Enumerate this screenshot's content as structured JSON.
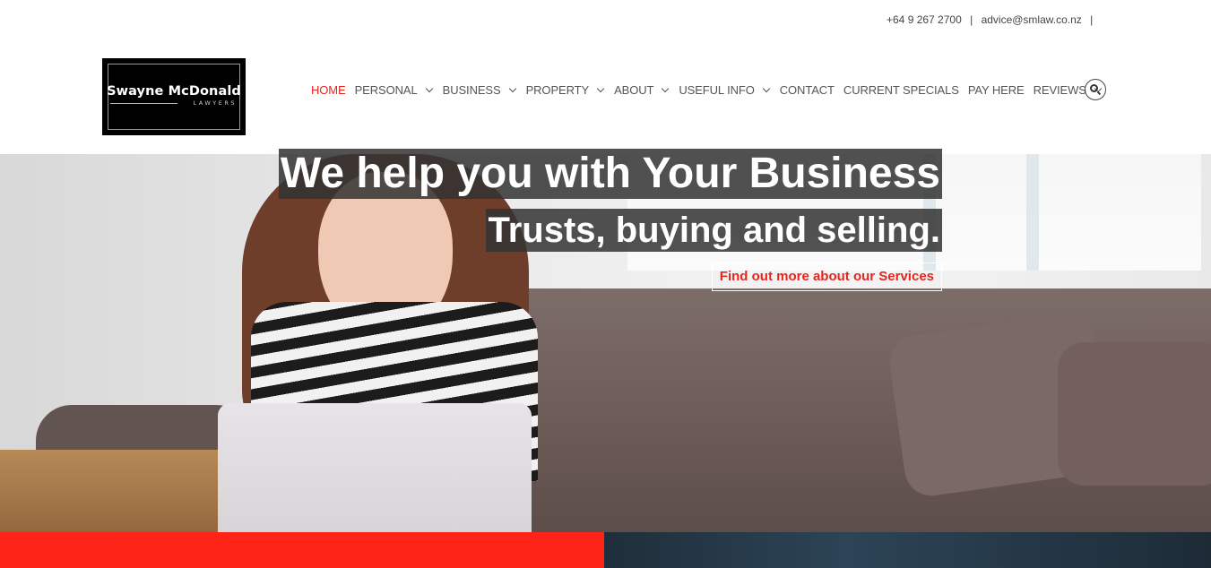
{
  "topbar": {
    "phone": "+64 9 267 2700",
    "separator": "|",
    "email": "advice@smlaw.co.nz",
    "trailing_separator": "|"
  },
  "logo": {
    "name": "Swayne McDonald",
    "subtitle": "LAWYERS"
  },
  "nav": {
    "items": [
      {
        "label": "HOME",
        "active": true,
        "has_dropdown": false
      },
      {
        "label": "PERSONAL",
        "active": false,
        "has_dropdown": true
      },
      {
        "label": "BUSINESS",
        "active": false,
        "has_dropdown": true
      },
      {
        "label": "PROPERTY",
        "active": false,
        "has_dropdown": true
      },
      {
        "label": "ABOUT",
        "active": false,
        "has_dropdown": true
      },
      {
        "label": "USEFUL INFO",
        "active": false,
        "has_dropdown": true
      },
      {
        "label": "CONTACT",
        "active": false,
        "has_dropdown": false
      },
      {
        "label": "CURRENT SPECIALS",
        "active": false,
        "has_dropdown": false
      },
      {
        "label": "PAY HERE",
        "active": false,
        "has_dropdown": false
      },
      {
        "label": "REVIEWS",
        "active": false,
        "has_dropdown": true
      }
    ],
    "search_icon": "search-icon"
  },
  "hero": {
    "title": "We help you with Your Business",
    "subtitle": "Trusts, buying and selling.",
    "cta": "Find out more about our Services"
  },
  "colors": {
    "accent": "#e5261e",
    "band_red": "#fe2417",
    "band_dark": "#1f2e3a",
    "nav_text": "#555555"
  }
}
